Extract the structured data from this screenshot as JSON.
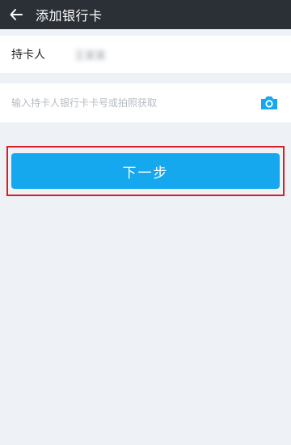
{
  "header": {
    "title": "添加银行卡",
    "back_icon": "arrow-left-icon"
  },
  "holder": {
    "label": "持卡人",
    "name": "王某某"
  },
  "card": {
    "placeholder": "输入持卡人银行卡卡号或拍照获取",
    "value": "",
    "camera_icon": "camera-icon"
  },
  "actions": {
    "next_label": "下一步"
  },
  "colors": {
    "header_bg": "#2b2f36",
    "accent": "#16a8ee",
    "highlight": "#d61f26",
    "page_bg": "#eef1f5"
  }
}
